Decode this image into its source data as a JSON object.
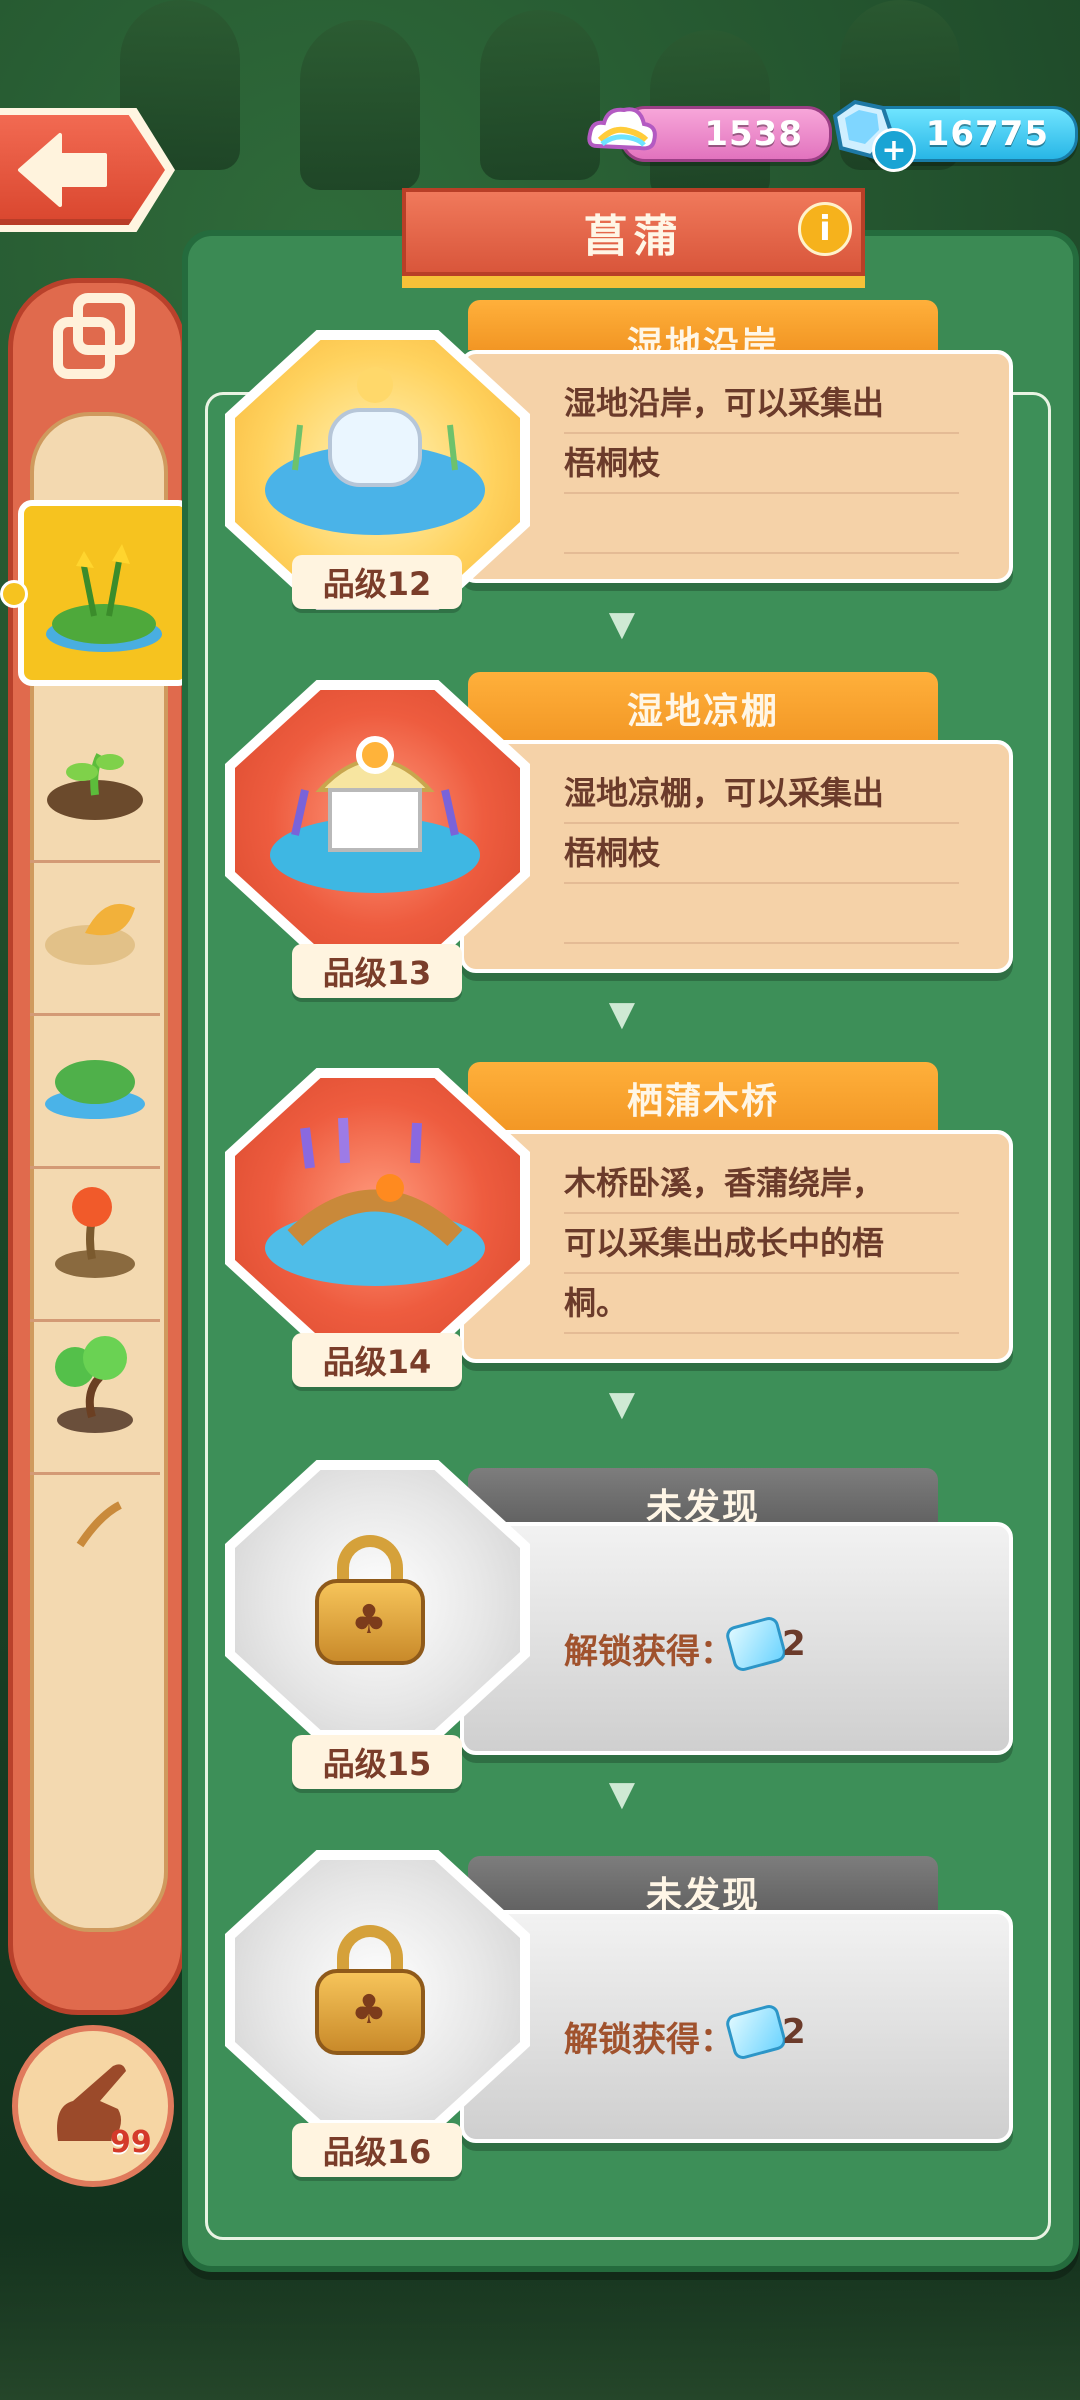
{
  "currency": {
    "rainbow": "1538",
    "gems": "16775"
  },
  "title": "菖蒲",
  "items": [
    {
      "name": "湿地沿岸",
      "desc_lines": [
        "湿地沿岸，可以采集出",
        "梧桐枝",
        ""
      ],
      "grade": "品级12",
      "state": "unlocked"
    },
    {
      "name": "湿地凉棚",
      "desc_lines": [
        "湿地凉棚，可以采集出",
        "梧桐枝",
        ""
      ],
      "grade": "品级13",
      "state": "unlocked"
    },
    {
      "name": "栖蒲木桥",
      "desc_lines": [
        "木桥卧溪，香蒲绕岸，",
        "可以采集出成长中的梧",
        "桐。"
      ],
      "grade": "品级14",
      "state": "unlocked"
    },
    {
      "name": "未发现",
      "unlock_label": "解锁获得：",
      "unlock_value": "2",
      "grade": "品级15",
      "state": "locked"
    },
    {
      "name": "未发现",
      "unlock_label": "解锁获得：",
      "unlock_value": "2",
      "grade": "品级16",
      "state": "locked"
    }
  ],
  "hand_count": "99",
  "colors": {
    "panel_green": "#3b8a54",
    "title_red": "#d9563b",
    "tab_orange": "#f29624",
    "tab_grey": "#6a6a6a",
    "card_tan": "#f5d2a8",
    "active_yellow": "#f6c31f"
  }
}
